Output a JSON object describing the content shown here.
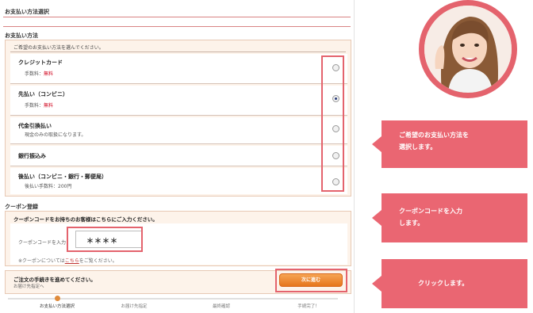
{
  "header": {
    "title": "お支払い方法選択"
  },
  "payment": {
    "section_title": "お支払い方法",
    "hint": "ご希望のお支払い方法を選んでください。",
    "options": [
      {
        "name": "クレジットカード",
        "sub_label": "手数料：",
        "sub_value": "無料",
        "selected": false
      },
      {
        "name": "先払い（コンビニ）",
        "sub_label": "手数料：",
        "sub_value": "無料",
        "selected": true
      },
      {
        "name": "代金引換払い",
        "sub_label": "現金のみの取扱になります。",
        "sub_value": "",
        "selected": false
      },
      {
        "name": "銀行振込み",
        "sub_label": "",
        "sub_value": "",
        "selected": false
      },
      {
        "name": "後払い（コンビニ・銀行・郵便局）",
        "sub_label": "後払い手数料：200円",
        "sub_value": "",
        "selected": false
      }
    ]
  },
  "coupon": {
    "section_title": "クーポン登録",
    "heading": "クーポンコードをお持ちのお客様はこちらにご入力ください。",
    "label": "クーポンコードを入力：",
    "value": "＊＊＊＊",
    "note_prefix": "※クーポンについては",
    "note_link": "こちら",
    "note_suffix": "をご覧ください。"
  },
  "proceed": {
    "main": "ご注文の手続きを進めてください。",
    "sub": "お届け先指定へ",
    "button_label": "次に進む"
  },
  "steps": [
    "お支払い方法選択",
    "お届け先指定",
    "最終確認",
    "手続完了！"
  ],
  "callouts": {
    "select_payment": [
      "ご希望のお支払い方法を",
      "選択します。"
    ],
    "enter_coupon": [
      "クーポンコードを入力",
      "します。"
    ],
    "click": [
      "クリックします。"
    ]
  },
  "colors": {
    "accent": "#ea6672",
    "highlight_frame": "#e4636d",
    "button": "#e6761c",
    "fee_red": "#d0021b"
  }
}
